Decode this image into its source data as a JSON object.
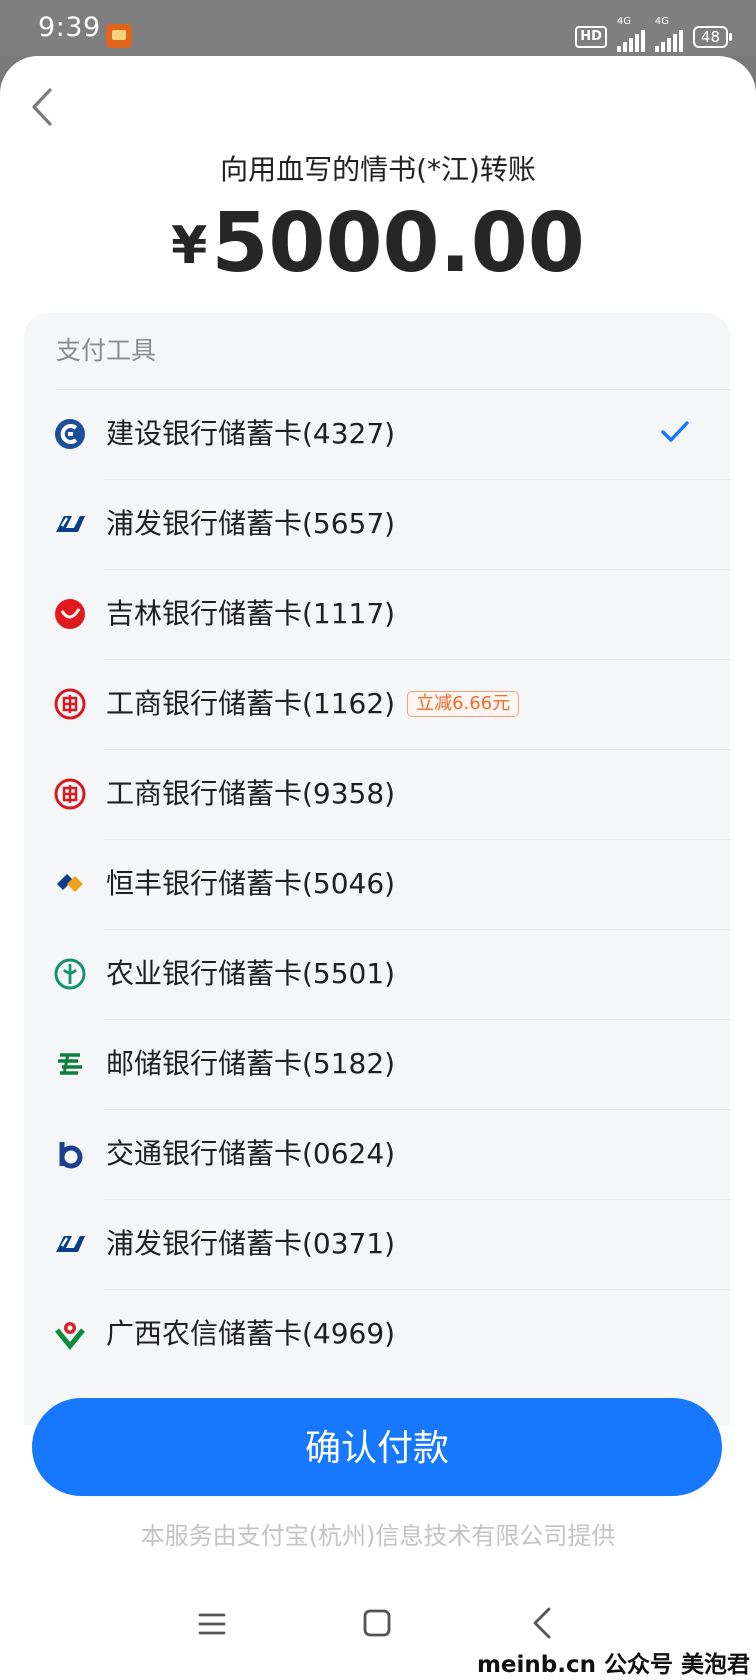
{
  "status_bar": {
    "time": "9:39",
    "hd_label": "HD",
    "network_1": "4G",
    "network_2": "4G",
    "battery": "48"
  },
  "header": {
    "title": "向用血写的情书(*江)转账",
    "currency_symbol": "¥",
    "amount": "5000.00"
  },
  "payment_tools": {
    "section_label": "支付工具",
    "selected_index": 0,
    "accent_color": "#1677ff",
    "items": [
      {
        "label": "建设银行储蓄卡(4327)",
        "icon": "ccb-logo-icon",
        "selected": true
      },
      {
        "label": "浦发银行储蓄卡(5657)",
        "icon": "spdb-logo-icon"
      },
      {
        "label": "吉林银行储蓄卡(1117)",
        "icon": "jilin-bank-logo-icon"
      },
      {
        "label": "工商银行储蓄卡(1162)",
        "icon": "icbc-logo-icon",
        "promo": "立减6.66元"
      },
      {
        "label": "工商银行储蓄卡(9358)",
        "icon": "icbc-logo-icon"
      },
      {
        "label": "恒丰银行储蓄卡(5046)",
        "icon": "hengfeng-bank-logo-icon"
      },
      {
        "label": "农业银行储蓄卡(5501)",
        "icon": "abc-logo-icon"
      },
      {
        "label": "邮储银行储蓄卡(5182)",
        "icon": "psbc-logo-icon"
      },
      {
        "label": "交通银行储蓄卡(0624)",
        "icon": "bocom-logo-icon"
      },
      {
        "label": "浦发银行储蓄卡(0371)",
        "icon": "spdb-logo-icon"
      },
      {
        "label": "广西农信储蓄卡(4969)",
        "icon": "guangxi-rcc-logo-icon"
      }
    ]
  },
  "confirm_button": {
    "label": "确认付款"
  },
  "footer": {
    "note": "本服务由支付宝(杭州)信息技术有限公司提供"
  },
  "watermark": "meinb.cn  公众号 美泡君"
}
